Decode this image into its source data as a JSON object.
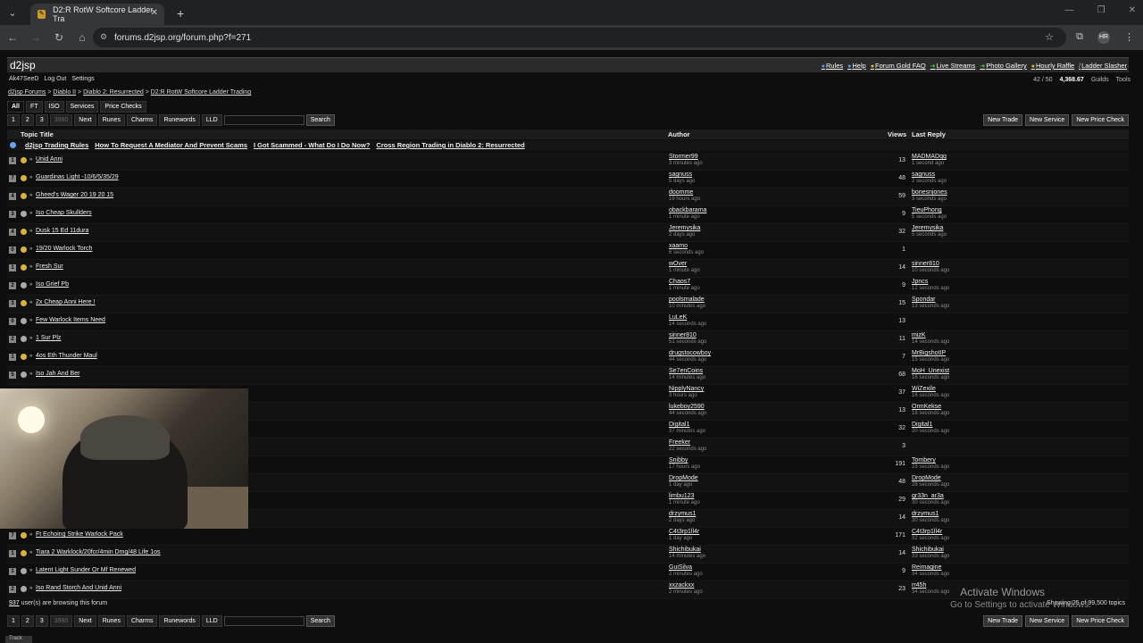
{
  "browser": {
    "tab_title": "D2:R RotW Softcore Ladder Tra",
    "url": "forums.d2jsp.org/forum.php?f=271",
    "profile": "HR"
  },
  "site": {
    "logo": "d2jsp",
    "links": [
      "Rules",
      "Help",
      "Forum Gold FAQ",
      "Live Streams",
      "Photo Gallery",
      "Hourly Raffle",
      "Ladder Slasher"
    ],
    "user": [
      "Ak47SeeD",
      "Log Out",
      "Settings"
    ],
    "counts": "42 / 50",
    "gold": "4,368.67",
    "right_links": [
      "Guilds",
      "Tools"
    ]
  },
  "breadcrumb": [
    "d2jsp Forums",
    "Diablo II",
    "Diablo 2: Resurrected",
    "D2:R RotW Softcore Ladder Trading"
  ],
  "filters": [
    "All",
    "FT",
    "ISO",
    "Services",
    "Price Checks"
  ],
  "pager": {
    "pages": [
      "1",
      "2",
      "3",
      "3980",
      "Next",
      "Runes",
      "Charms",
      "Runewords",
      "LLD"
    ],
    "search": "Search"
  },
  "actions": [
    "New Trade",
    "New Service",
    "New Price Check"
  ],
  "columns": {
    "topic": "Topic Title",
    "author": "Author",
    "views": "Views",
    "last": "Last Reply"
  },
  "sticky": [
    "d2jsp Trading Rules",
    "How To Request A Mediator And Prevent Scams",
    "I Got Scammed - What Do I Do Now?",
    "Cross Region Trading in Diablo 2: Resurrected"
  ],
  "rows": [
    {
      "rep": "1",
      "t": "Unid Anni",
      "a": "Stormer99",
      "at": "3 minutes ago",
      "v": "13",
      "l": "MADMADqq",
      "lt": "1 second ago",
      "c": "#d9b43a"
    },
    {
      "rep": "7",
      "t": "Guardinas Light -10/6/5/35/29",
      "a": "sagnuss",
      "at": "5 days ago",
      "v": "48",
      "l": "sagnuss",
      "lt": "2 seconds ago",
      "c": "#d9b43a"
    },
    {
      "rep": "4",
      "t": "Gheed's Wager 20 19 20 15",
      "a": "doomme",
      "at": "19 hours ago",
      "v": "59",
      "l": "bonesnjones",
      "lt": "3 seconds ago",
      "c": "#d9b43a"
    },
    {
      "rep": "3",
      "t": "Iso Cheap Skullders",
      "a": "obackbarama",
      "at": "1 minute ago",
      "v": "9",
      "l": "TieuPhong",
      "lt": "5 seconds ago",
      "c": "#aaa"
    },
    {
      "rep": "4",
      "t": "Dusk 15 Ed 11dura",
      "a": "Jeremysika",
      "at": "2 days ago",
      "v": "32",
      "l": "Jeremysika",
      "lt": "5 seconds ago",
      "c": "#d9b43a"
    },
    {
      "rep": "0",
      "t": "19/20 Warlock Torch",
      "a": "xaamo",
      "at": "6 seconds ago",
      "v": "1",
      "l": "",
      "lt": "",
      "c": "#d9b43a"
    },
    {
      "rep": "1",
      "t": "Fresh Sur",
      "a": "wOver",
      "at": "1 minute ago",
      "v": "14",
      "l": "sinner810",
      "lt": "10 seconds ago",
      "c": "#d9b43a"
    },
    {
      "rep": "2",
      "t": "Iso Grief Pb",
      "a": "Chaos7",
      "at": "1 minute ago",
      "v": "9",
      "l": "Jpncs",
      "lt": "12 seconds ago",
      "c": "#aaa"
    },
    {
      "rep": "3",
      "t": "2x Cheap Anni Here !",
      "a": "poolsmalade",
      "at": "10 minutes ago",
      "v": "15",
      "l": "Spondar",
      "lt": "13 seconds ago",
      "c": "#d9b43a"
    },
    {
      "rep": "0",
      "t": "Few Warlock Items Need",
      "a": "LuLeK",
      "at": "14 seconds ago",
      "v": "13",
      "l": "",
      "lt": "",
      "c": "#aaa"
    },
    {
      "rep": "2",
      "t": "1 Sur Plz",
      "a": "sinner810",
      "at": "51 seconds ago",
      "v": "11",
      "l": "mizK",
      "lt": "14 seconds ago",
      "c": "#aaa"
    },
    {
      "rep": "1",
      "t": "4os Eth Thunder Maul",
      "a": "drugstocowboy",
      "at": "44 seconds ago",
      "v": "7",
      "l": "MrBigshotIP",
      "lt": "15 seconds ago",
      "c": "#d9b43a"
    },
    {
      "rep": "5",
      "t": "Iso Jah And Ber",
      "a": "Se7enCoins",
      "at": "14 minutes ago",
      "v": "68",
      "l": "MoH_Unexist",
      "lt": "16 seconds ago",
      "c": "#aaa"
    },
    {
      "rep": "",
      "t": "",
      "a": "NipplyNancy",
      "at": "3 hours ago",
      "v": "37",
      "l": "WiZexile",
      "lt": "16 seconds ago",
      "c": "#aaa"
    },
    {
      "rep": "",
      "t": "",
      "a": "lukeboy2590",
      "at": "44 seconds ago",
      "v": "13",
      "l": "OrmKekse",
      "lt": "18 seconds ago",
      "c": "#aaa"
    },
    {
      "rep": "",
      "t": "",
      "a": "Digital1",
      "at": "37 minutes ago",
      "v": "32",
      "l": "Digital1",
      "lt": "20 seconds ago",
      "c": "#aaa"
    },
    {
      "rep": "",
      "t": "",
      "a": "Freeker",
      "at": "22 seconds ago",
      "v": "3",
      "l": "",
      "lt": "",
      "c": "#aaa"
    },
    {
      "rep": "",
      "t": "",
      "a": "Snibby",
      "at": "17 hours ago",
      "v": "191",
      "l": "Tombery",
      "lt": "23 seconds ago",
      "c": "#aaa"
    },
    {
      "rep": "",
      "t": "",
      "a": "DropMode",
      "at": "1 day ago",
      "v": "48",
      "l": "DropMode",
      "lt": "28 seconds ago",
      "c": "#aaa"
    },
    {
      "rep": "",
      "t": "",
      "a": "limbu123",
      "at": "1 minute ago",
      "v": "29",
      "l": "gr33n_ar3a",
      "lt": "30 seconds ago",
      "c": "#aaa"
    },
    {
      "rep": "",
      "t": "",
      "a": "drzymus1",
      "at": "2 days ago",
      "v": "14",
      "l": "drzymus1",
      "lt": "30 seconds ago",
      "c": "#aaa"
    },
    {
      "rep": "7",
      "t": "Ft Echoing Strike Warlock Pack",
      "a": "C4t3rp1ll4r",
      "at": "1 day ago",
      "v": "171",
      "l": "C4t3rp1ll4r",
      "lt": "32 seconds ago",
      "c": "#d9b43a"
    },
    {
      "rep": "1",
      "t": "Tiara 2 Warklock/20fcr/4min Dmg/48 Life 1os",
      "a": "Shichibukai",
      "at": "14 minutes ago",
      "v": "14",
      "l": "Shichibukai",
      "lt": "33 seconds ago",
      "c": "#d9b43a"
    },
    {
      "rep": "1",
      "t": "Latent Light Sunder Or Mf Renewed",
      "a": "GuiSilva",
      "at": "2 minutes ago",
      "v": "9",
      "l": "Reimagine",
      "lt": "34 seconds ago",
      "c": "#aaa"
    },
    {
      "rep": "2",
      "t": "Iso Rand Storch And Unid Anni",
      "a": "xxzackxx",
      "at": "2 minutes ago",
      "v": "23",
      "l": "rr45h",
      "lt": "34 seconds ago",
      "c": "#aaa"
    }
  ],
  "browsing": {
    "count": "937",
    "text": " user(s) are browsing this forum"
  },
  "showing": "Showing 25 of 99,500 topics",
  "watermark": {
    "line1": "Activate Windows",
    "line2": "Go to Settings to activate Windows."
  },
  "bottom_tab": "Track"
}
